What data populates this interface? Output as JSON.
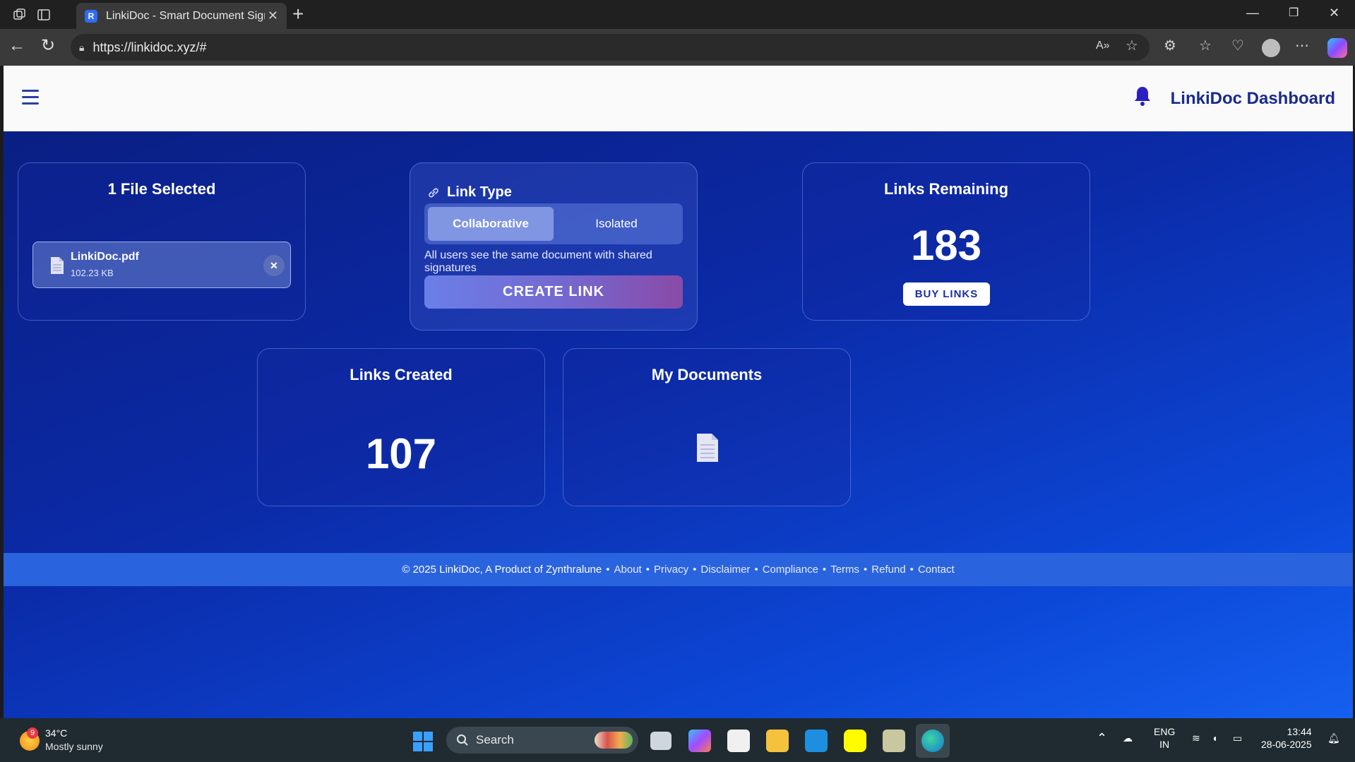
{
  "browser": {
    "tab_title": "LinkiDoc - Smart Document Signi",
    "url": "https://linkidoc.xyz/#"
  },
  "header": {
    "brand": "LinkiDoc Dashboard"
  },
  "file_card": {
    "title": "1 File Selected",
    "file_name": "LinkiDoc.pdf",
    "file_size": "102.23 KB",
    "remove_glyph": "✕"
  },
  "link_type_card": {
    "title": "Link Type",
    "options": [
      "Collaborative",
      "Isolated"
    ],
    "selected": "Collaborative",
    "description": "All users see the same document with shared signatures",
    "create_label": "CREATE LINK"
  },
  "remaining_card": {
    "title": "Links Remaining",
    "value": "183",
    "buy_label": "BUY LINKS"
  },
  "created_card": {
    "title": "Links Created",
    "value": "107"
  },
  "documents_card": {
    "title": "My Documents"
  },
  "footer": {
    "copyright": "© 2025 LinkiDoc, A Product of Zynthralune",
    "links": [
      "About",
      "Privacy",
      "Disclaimer",
      "Compliance",
      "Terms",
      "Refund",
      "Contact"
    ]
  },
  "taskbar": {
    "weather_badge": "9",
    "temperature": "34°C",
    "condition": "Mostly sunny",
    "search_label": "Search",
    "lang_top": "ENG",
    "lang_bottom": "IN",
    "time": "13:44",
    "date": "28-06-2025"
  },
  "colors": {
    "accent": "#1a2a8c",
    "page_gradient_start": "#0a1d7f",
    "page_gradient_end": "#1560f0",
    "footer": "#2a63de"
  }
}
